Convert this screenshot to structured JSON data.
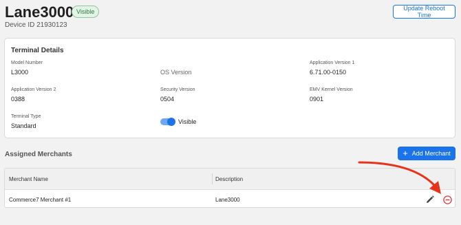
{
  "header": {
    "title": "Lane3000",
    "visibility_badge": "Visible",
    "device_id": "Device ID 21930123",
    "update_reboot_button": "Update Reboot Time"
  },
  "terminal_details": {
    "title": "Terminal Details",
    "fields": {
      "model_number": {
        "label": "Model Number",
        "value": "L3000"
      },
      "os_version": {
        "value": "OS Version"
      },
      "app_version_1": {
        "label": "Application Version 1",
        "value": "6.71.00-0150"
      },
      "app_version_2": {
        "label": "Application Version 2",
        "value": "0388"
      },
      "security_version": {
        "label": "Security Version",
        "value": "0504"
      },
      "emv_kernel_version": {
        "label": "EMV Kernel Version",
        "value": "0901"
      },
      "terminal_type": {
        "label": "Terminal Type",
        "value": "Standard"
      }
    },
    "visibility_toggle": {
      "label": "Visible",
      "on": true
    }
  },
  "assigned_merchants": {
    "title": "Assigned Merchants",
    "add_button": "Add Merchant",
    "columns": [
      "Merchant Name",
      "Description"
    ],
    "rows": [
      {
        "merchant_name": "Commerce7 Merchant #1",
        "description": "Lane3000"
      }
    ]
  },
  "colors": {
    "accent": "#1a73e8",
    "badge_bg": "#e3f3e6",
    "badge_text": "#2f7a3d",
    "annotation_arrow": "#e8331c",
    "remove_icon": "#e53935"
  },
  "icons": [
    "plus-icon",
    "edit-icon",
    "remove-icon",
    "annotation-arrow"
  ]
}
